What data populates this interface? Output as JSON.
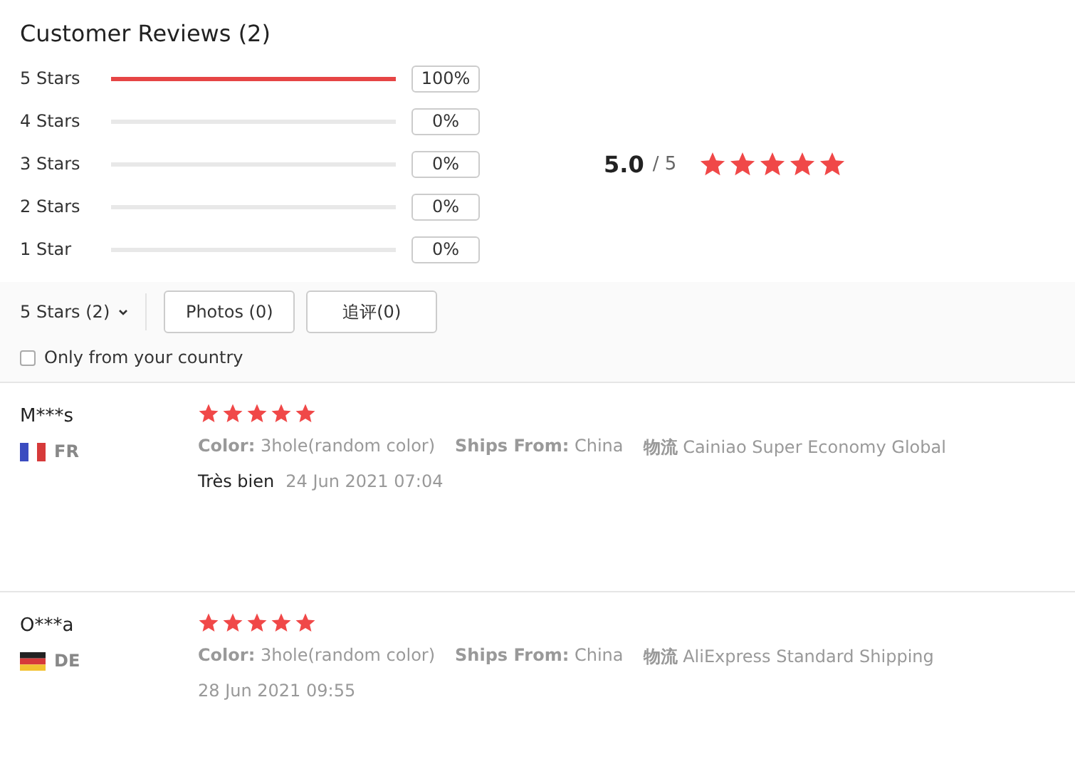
{
  "title": "Customer Reviews (2)",
  "histogram": [
    {
      "label": "5 Stars",
      "level": 1,
      "percent": "100%"
    },
    {
      "label": "4 Stars",
      "level": 0,
      "percent": "0%"
    },
    {
      "label": "3 Stars",
      "level": 0,
      "percent": "0%"
    },
    {
      "label": "2 Stars",
      "level": 0,
      "percent": "0%"
    },
    {
      "label": "1 Star",
      "level": 0,
      "percent": "0%"
    }
  ],
  "summary": {
    "score": "5.0",
    "out_of": "/ 5",
    "stars": 5
  },
  "filters": {
    "dropdown": "5 Stars (2)",
    "buttons": [
      "Photos (0)",
      "追评(0)"
    ],
    "checkbox": {
      "label": "Only from your country",
      "checked": false
    }
  },
  "reviews": [
    {
      "name": "M***s",
      "country": "FR",
      "kind": "fr",
      "stars": 5,
      "attributes": [
        {
          "label": "Color:",
          "value": "3hole(random color)"
        },
        {
          "label": "Ships From:",
          "value": "China"
        },
        {
          "label": "物流",
          "value": "Cainiao Super Economy Global"
        }
      ],
      "comment": "Très bien",
      "date": "24 Jun 2021 07:04"
    },
    {
      "name": "O***a",
      "country": "DE",
      "kind": "de",
      "stars": 5,
      "attributes": [
        {
          "label": "Color:",
          "value": "3hole(random color)"
        },
        {
          "label": "Ships From:",
          "value": "China"
        },
        {
          "label": "物流",
          "value": "AliExpress Standard Shipping"
        }
      ],
      "date": "28 Jun 2021 09:55"
    }
  ]
}
